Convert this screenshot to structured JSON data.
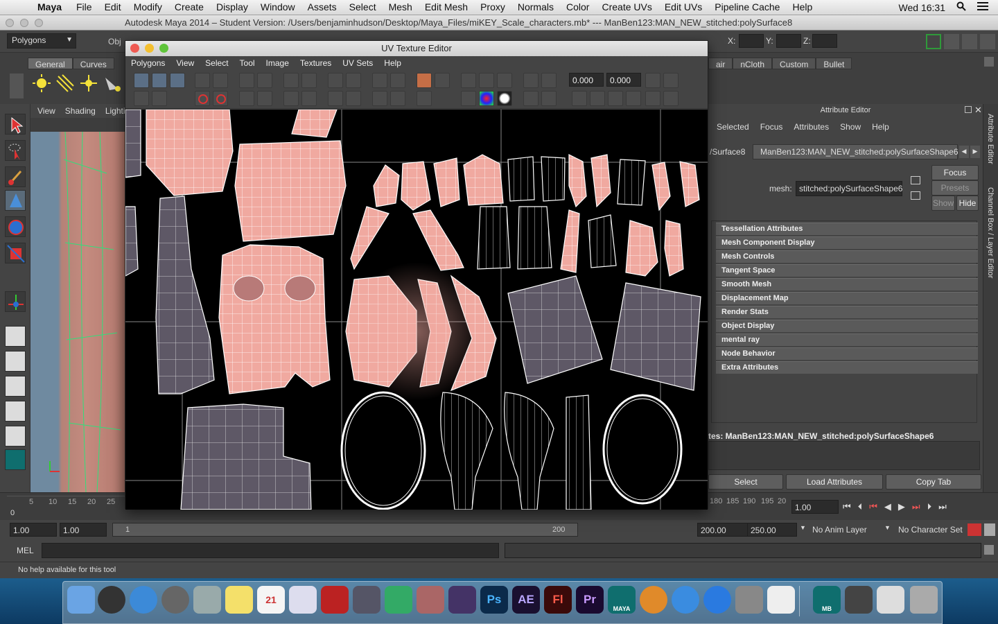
{
  "menubar": {
    "app": "Maya",
    "items": [
      "File",
      "Edit",
      "Modify",
      "Create",
      "Display",
      "Window",
      "Assets",
      "Select",
      "Mesh",
      "Edit Mesh",
      "Proxy",
      "Normals",
      "Color",
      "Create UVs",
      "Edit UVs",
      "Pipeline Cache",
      "Help"
    ],
    "clock": "Wed 16:31"
  },
  "titlebar": {
    "title": "Autodesk Maya 2014 – Student Version: /Users/benjaminhudson/Desktop/Maya_Files/miKEY_Scale_characters.mb*   ---   ManBen123:MAN_NEW_stitched:polySurface8"
  },
  "status": {
    "mode": "Polygons",
    "obj_label": "Obj",
    "x_label": "X:",
    "y_label": "Y:",
    "z_label": "Z:"
  },
  "shelf": {
    "tabs": [
      "General",
      "Curves"
    ],
    "tabs_right": [
      "air",
      "nCloth",
      "Custom",
      "Bullet"
    ]
  },
  "viewport": {
    "menu": [
      "View",
      "Shading",
      "Lighti"
    ]
  },
  "uv_editor": {
    "title": "UV Texture Editor",
    "menu": [
      "Polygons",
      "View",
      "Select",
      "Tool",
      "Image",
      "Textures",
      "UV Sets",
      "Help"
    ],
    "u_value": "0.000",
    "v_value": "0.000"
  },
  "attribute_editor": {
    "header": "Attribute Editor",
    "menu": [
      "Selected",
      "Focus",
      "Attributes",
      "Show",
      "Help"
    ],
    "tab_left": "/Surface8",
    "tab_active": "ManBen123:MAN_NEW_stitched:polySurfaceShape6",
    "mesh_label": "mesh:",
    "mesh_value": "stitched:polySurfaceShape6",
    "buttons": {
      "focus": "Focus",
      "presets": "Presets",
      "show": "Show",
      "hide": "Hide"
    },
    "sections": [
      "Tessellation Attributes",
      "Mesh Component Display",
      "Mesh Controls",
      "Tangent Space",
      "Smooth Mesh",
      "Displacement Map",
      "Render Stats",
      "Object Display",
      "mental ray",
      "Node Behavior",
      "Extra Attributes"
    ],
    "notes": "tes:  ManBen123:MAN_NEW_stitched:polySurfaceShape6",
    "bottom_buttons": [
      "Select",
      "Load Attributes",
      "Copy Tab"
    ]
  },
  "side_tabs": [
    "Attribute Editor",
    "Channel Box / Layer Editor"
  ],
  "timeline": {
    "ticks_left": [
      "5",
      "10",
      "15",
      "20",
      "25"
    ],
    "ticks_right": [
      "180",
      "185",
      "190",
      "195",
      "20"
    ],
    "frame_zero": "0",
    "current_frame": "1.00"
  },
  "range": {
    "start": "1.00",
    "start2": "1.00",
    "slider_start": "1",
    "slider_end": "200",
    "end": "200.00",
    "end2": "250.00",
    "anim_layer": "No Anim Layer",
    "char_set": "No Character Set"
  },
  "command": {
    "label": "MEL"
  },
  "help": {
    "text": "No help available for this tool"
  },
  "dock": {
    "apps": [
      "Ps",
      "AE",
      "Fl",
      "Pr"
    ],
    "maya_label": "MAYA",
    "mb_label": "MB"
  },
  "colors": {
    "uv_fill": "#f0a9a0",
    "uv_gray": "#5e5866",
    "canvas": "#000000"
  }
}
